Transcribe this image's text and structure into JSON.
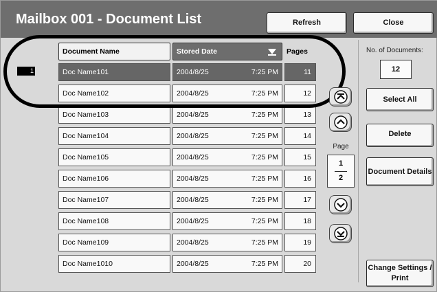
{
  "window": {
    "title": "Mailbox 001 - Document List"
  },
  "header": {
    "refresh_label": "Refresh",
    "close_label": "Close"
  },
  "table": {
    "columns": {
      "name": "Document Name",
      "date": "Stored Date",
      "pages": "Pages"
    },
    "selected_index_label": "1",
    "rows": [
      {
        "name": "Doc Name101",
        "date": "2004/8/25",
        "time": "7:25 PM",
        "pages": "11",
        "selected": true
      },
      {
        "name": "Doc Name102",
        "date": "2004/8/25",
        "time": "7:25 PM",
        "pages": "12",
        "selected": false
      },
      {
        "name": "Doc Name103",
        "date": "2004/8/25",
        "time": "7:25 PM",
        "pages": "13",
        "selected": false
      },
      {
        "name": "Doc Name104",
        "date": "2004/8/25",
        "time": "7:25 PM",
        "pages": "14",
        "selected": false
      },
      {
        "name": "Doc Name105",
        "date": "2004/8/25",
        "time": "7:25 PM",
        "pages": "15",
        "selected": false
      },
      {
        "name": "Doc Name106",
        "date": "2004/8/25",
        "time": "7:25 PM",
        "pages": "16",
        "selected": false
      },
      {
        "name": "Doc Name107",
        "date": "2004/8/25",
        "time": "7:25 PM",
        "pages": "17",
        "selected": false
      },
      {
        "name": "Doc Name108",
        "date": "2004/8/25",
        "time": "7:25 PM",
        "pages": "18",
        "selected": false
      },
      {
        "name": "Doc Name109",
        "date": "2004/8/25",
        "time": "7:25 PM",
        "pages": "19",
        "selected": false
      },
      {
        "name": "Doc Name1010",
        "date": "2004/8/25",
        "time": "7:25 PM",
        "pages": "20",
        "selected": false
      }
    ]
  },
  "pagination": {
    "label": "Page",
    "current": "1",
    "total": "2"
  },
  "sidebar": {
    "docs_label": "No. of Documents:",
    "docs_count": "12",
    "select_all_label": "Select All",
    "delete_label": "Delete",
    "details_label": "Document Details",
    "change_label": "Change Settings / Print"
  },
  "icons": {
    "sort": "sort-descending-icon",
    "first": "first-page-icon",
    "prev": "page-up-icon",
    "next": "page-down-icon",
    "last": "last-page-icon"
  },
  "colors": {
    "header": "#6e6e6e",
    "selected_row": "#666666",
    "background": "#d9d9d9"
  }
}
